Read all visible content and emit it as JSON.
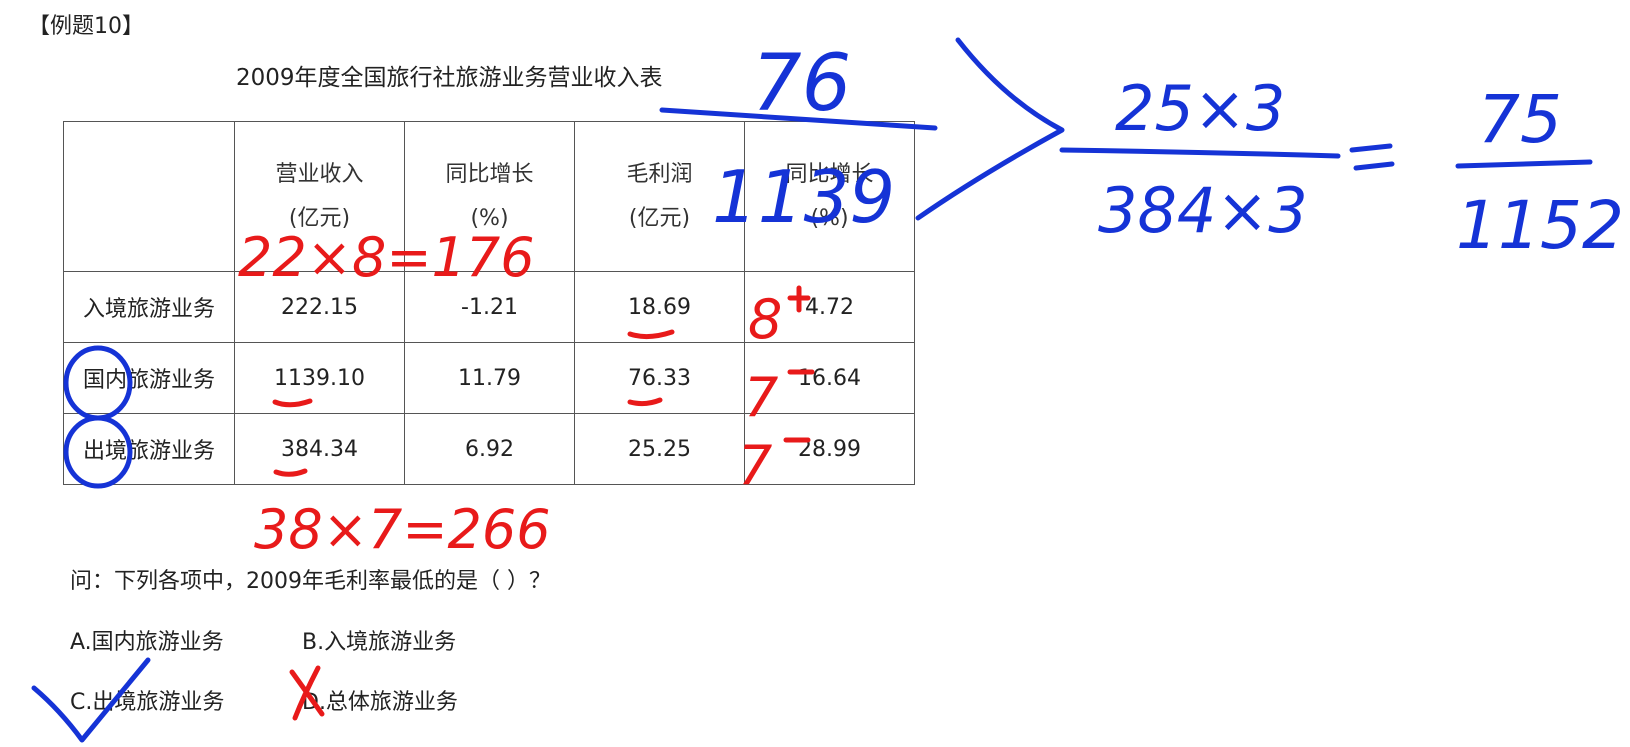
{
  "problem_label": "【例题10】",
  "table_title": "2009年度全国旅行社旅游业务营业收入表",
  "table": {
    "headers": [
      {
        "line1": "",
        "line2": ""
      },
      {
        "line1": "营业收入",
        "line2": "(亿元)"
      },
      {
        "line1": "同比增长",
        "line2": "(%)"
      },
      {
        "line1": "毛利润",
        "line2": "(亿元)"
      },
      {
        "line1": "同比增长",
        "line2": "(%)"
      }
    ],
    "rows": [
      {
        "name": "入境旅游业务",
        "cells": [
          "222.15",
          "-1.21",
          "18.69",
          "4.72"
        ]
      },
      {
        "name": "国内旅游业务",
        "cells": [
          "1139.10",
          "11.79",
          "76.33",
          "16.64"
        ]
      },
      {
        "name": "出境旅游业务",
        "cells": [
          "384.34",
          "6.92",
          "25.25",
          "28.99"
        ]
      }
    ]
  },
  "question": "问：下列各项中，2009年毛利率最低的是（ ）？",
  "options": {
    "a": "A.国内旅游业务",
    "b": "B.入境旅游业务",
    "c": "C.出境旅游业务",
    "d": "D.总体旅游业务"
  },
  "annotations": {
    "calc1": "22×8=176",
    "calc2": "38×7=266",
    "mark_row1": "8",
    "mark_row2": "7",
    "mark_row3": "7",
    "frac1_num": "76",
    "frac1_den": "1139",
    "frac2_num": "25×3",
    "frac2_den": "384×3",
    "frac3_num": "75",
    "frac3_den": "1152",
    "greater": ">",
    "equals": "=",
    "colors": {
      "red_ink": "#e81a1a",
      "blue_ink": "#1533d6"
    }
  }
}
